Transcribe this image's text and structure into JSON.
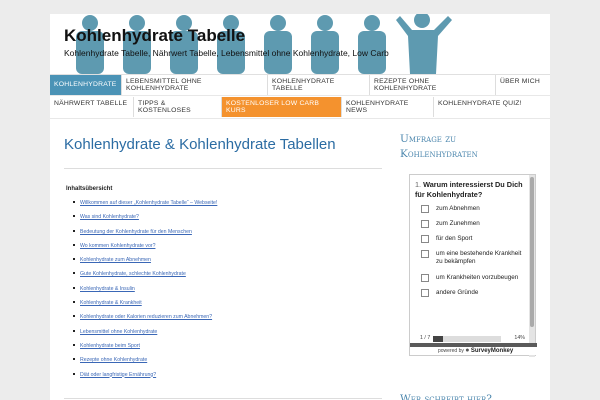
{
  "site": {
    "title": "Kohlenhydrate Tabelle",
    "description": "Kohlenhydrate Tabelle, Nährwert Tabelle, Lebensmittel ohne Kohlenhydrate, Low Carb"
  },
  "nav": {
    "row1": [
      "Kohlenhydrate",
      "Lebensmittel ohne Kohlenhydrate",
      "Kohlenhydrate Tabelle",
      "Rezepte ohne Kohlenhydrate",
      "Über mich"
    ],
    "row2": [
      "Nährwert Tabelle",
      "Tipps & Kostenloses",
      "Kostenloser Low Carb Kurs",
      "Kohlenhydrate News",
      "Kohlenhydrate Quiz!"
    ]
  },
  "main": {
    "title": "Kohlenhydrate & Kohlenhydrate Tabellen",
    "toc_title": "Inhaltsübersicht",
    "toc": [
      "Willkommen auf dieser „Kohlenhydrate Tabelle“ – Webseite!",
      "Was sind Kohlenhydrate?",
      "Bedeutung der Kohlenhydrate für den Menschen",
      "Wo kommen Kohlenhydrate vor?",
      "Kohlenhydrate zum Abnehmen",
      "Gute Kohlenhydrate, schlechte Kohlenhydrate",
      "Kohlenhydrate & Insulin",
      "Kohlenhydrate & Krankheit",
      "Kohlenhydrate oder Kalorien reduzieren zum Abnehmen?",
      "Lebensmittel ohne Kohlenhydrate",
      "Kohlenhydrate beim Sport",
      "Rezepte ohne Kohlenhydrate",
      "Diät oder langfristige Ernährung?"
    ]
  },
  "sidebar": {
    "widget1_title_line1": "Umfrage zu",
    "widget1_title_line2": "Kohlenhydraten",
    "poll": {
      "number": "1.",
      "question": "Warum interessierst Du Dich für Kohlenhydrate?",
      "options": [
        "zum Abnehmen",
        "zum Zunehmen",
        "für den Sport",
        "um eine bestehende Krankheit zu bekämpfen",
        "um Krankheiten vorzubeugen",
        "andere Gründe"
      ],
      "progress_label": "1 / 7",
      "progress_value": 0.14,
      "progress_pct": "14%",
      "powered_by": "powered by",
      "brand": "SurveyMonkey"
    },
    "widget2_title": "Wer schreibt hier?"
  }
}
